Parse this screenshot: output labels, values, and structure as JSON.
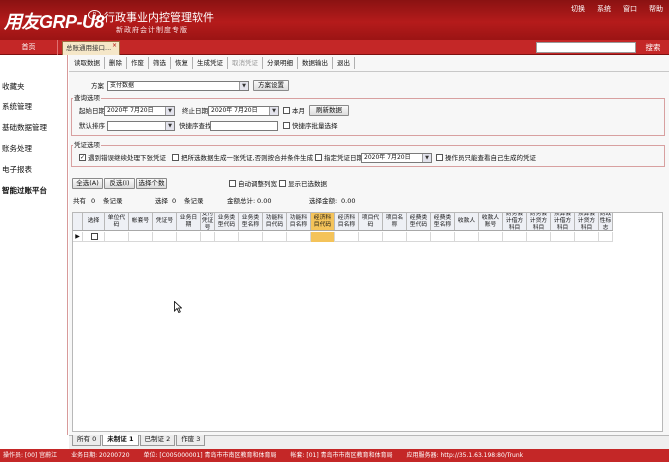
{
  "header": {
    "logo_text": "用友GRP-U8",
    "logo_badge": "R",
    "app_title": "行政事业内控管理软件",
    "app_subtitle": "新政府会计制度专版",
    "top_menu": [
      "切换",
      "系统",
      "窗口",
      "帮助"
    ]
  },
  "nav": {
    "home_label": "首页",
    "active_tab": "总账通用接口...",
    "close_glyph": "×",
    "search_label": "搜索"
  },
  "sidebar": {
    "items": [
      {
        "label": "收藏夹"
      },
      {
        "label": "系统管理"
      },
      {
        "label": "基础数据管理"
      },
      {
        "label": "账务处理"
      },
      {
        "label": "电子报表"
      },
      {
        "label": "智能过账平台"
      }
    ]
  },
  "toolbar": {
    "items": [
      {
        "label": "读取数据",
        "enabled": true
      },
      {
        "label": "删除",
        "enabled": true
      },
      {
        "label": "作废",
        "enabled": true
      },
      {
        "label": "筛选",
        "enabled": true
      },
      {
        "label": "恢复",
        "enabled": true
      },
      {
        "label": "生成凭证",
        "enabled": true
      },
      {
        "label": "取消凭证",
        "enabled": false
      },
      {
        "label": "分录明细",
        "enabled": true
      },
      {
        "label": "数据输出",
        "enabled": true
      },
      {
        "label": "退出",
        "enabled": true
      }
    ]
  },
  "scheme": {
    "label": "方案",
    "value": "支付数据",
    "button": "方案设置"
  },
  "query": {
    "title": "查询选项",
    "start_date_label": "起始日期",
    "start_date": "2020年 7月20日",
    "end_date_label": "终止日期",
    "end_date": "2020年 7月20日",
    "this_month_label": "本月",
    "refresh_button": "刷新数据",
    "sort_label": "默认排序",
    "sort_value": "",
    "quick_find_label": "快捷序查找",
    "quick_find_value": "",
    "quick_select_label": "快捷序批量选择"
  },
  "voucher": {
    "title": "凭证选项",
    "opt1_label": "遇到错误继续处理下张凭证",
    "opt1_checked": true,
    "opt2_label": "把所选数据生成一张凭证,否则按合并条件生成",
    "opt2_checked": false,
    "opt3_label": "指定凭证日期",
    "opt3_checked": false,
    "voucher_date": "2020年 7月20日",
    "opt4_label": "操作员只能查看自己生成的凭证",
    "opt4_checked": false
  },
  "actions": {
    "select_all": "全选(A)",
    "invert": "反选(I)",
    "select_count": "选择个数",
    "auto_width_label": "自动调整列宽",
    "show_selected_label": "显示已选数据"
  },
  "summary": {
    "total_label": "共有",
    "total_count": "0",
    "records_unit": "条记录",
    "selected_label": "选择",
    "selected_count": "0",
    "amount_total_label": "金额总计:",
    "amount_total": "0.00",
    "selected_amount_label": "选择金额:",
    "selected_amount": "0.00"
  },
  "grid": {
    "columns": [
      "选择",
      "单位代码",
      "帐套号",
      "凭证号",
      "业务日期",
      "支付凭证号",
      "业务类型代码",
      "业务类型名称",
      "功能科目代码",
      "功能科目名称",
      "经济科目代码",
      "经济科目名称",
      "项目代码",
      "项目名称",
      "经费类型代码",
      "经费类型名称",
      "收款人",
      "收款人账号",
      "财务会计借方科目",
      "财务会计贷方科目",
      "预算会计借方科目",
      "预算会计贷方科目",
      "财政性标志"
    ],
    "row_marker": "▶"
  },
  "bottom_tabs": [
    {
      "label": "所有 0",
      "active": false
    },
    {
      "label": "未制证 1",
      "active": true
    },
    {
      "label": "已制证 2",
      "active": false
    },
    {
      "label": "作废 3",
      "active": false
    }
  ],
  "status": {
    "operator": "操作员: [00] 宫蔚江",
    "biz_date": "业务日期: 20200720",
    "unit": "单位: [C005000001] 青岛市市南区教育和体育局",
    "account_set": "帐套: [01] 青岛市市南区教育和体育局",
    "server": "应用服务器: http://35.1.63.198:80/Trunk"
  }
}
